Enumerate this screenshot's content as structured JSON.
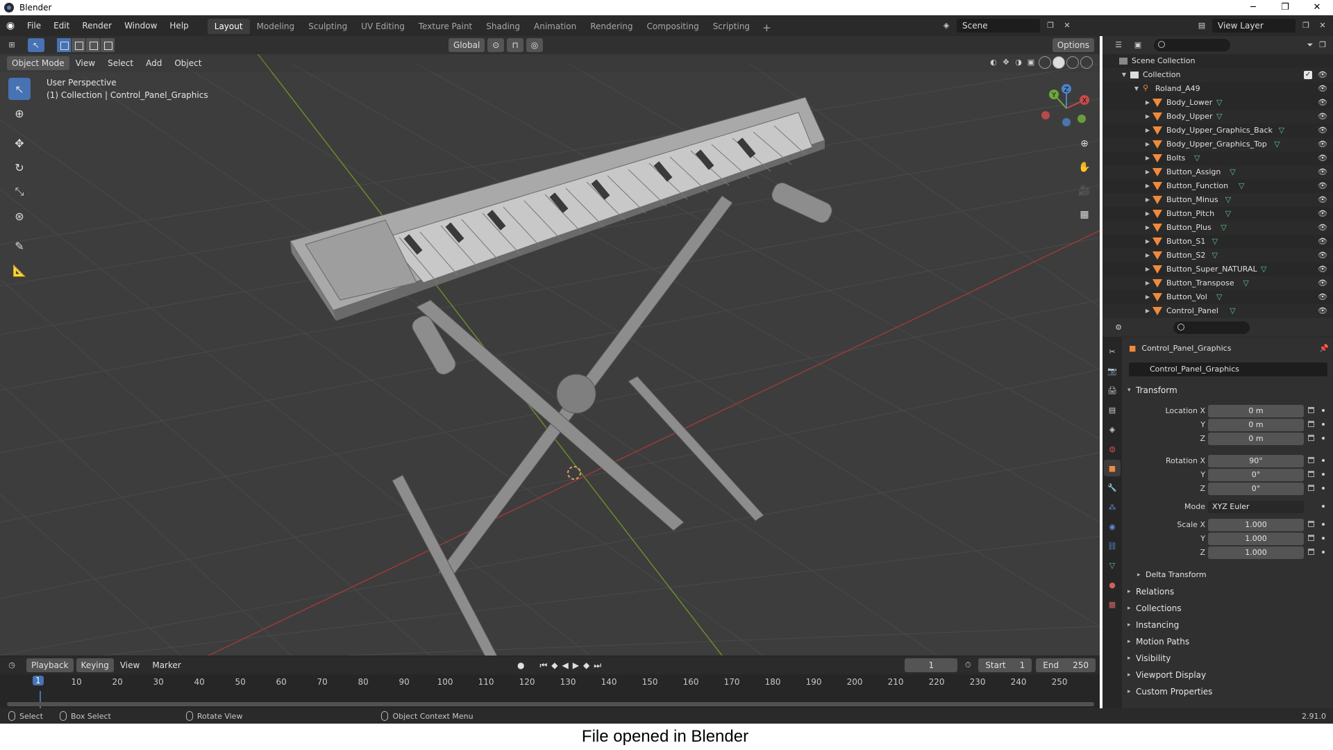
{
  "window": {
    "title": "Blender",
    "controls": [
      "─",
      "❐",
      "✕"
    ]
  },
  "menu": [
    "File",
    "Edit",
    "Render",
    "Window",
    "Help"
  ],
  "workspaces": [
    {
      "label": "Layout",
      "active": true
    },
    {
      "label": "Modeling"
    },
    {
      "label": "Sculpting"
    },
    {
      "label": "UV Editing"
    },
    {
      "label": "Texture Paint"
    },
    {
      "label": "Shading"
    },
    {
      "label": "Animation"
    },
    {
      "label": "Rendering"
    },
    {
      "label": "Compositing"
    },
    {
      "label": "Scripting"
    }
  ],
  "add_workspace": "+",
  "scene": {
    "value": "Scene"
  },
  "view_layer": {
    "value": "View Layer"
  },
  "viewport": {
    "mode": "Object Mode",
    "menus": [
      "View",
      "Select",
      "Add",
      "Object"
    ],
    "transform_orientation": "Global",
    "options": "Options",
    "perspective": "User Perspective",
    "collection_info": "(1) Collection | Control_Panel_Graphics",
    "gizmo": {
      "x": "X",
      "y": "Y",
      "z": "Z"
    }
  },
  "outliner": {
    "root": "Scene Collection",
    "collection": "Collection",
    "parent": "Roland_A49",
    "children": [
      "Body_Lower",
      "Body_Upper",
      "Body_Upper_Graphics_Back",
      "Body_Upper_Graphics_Top",
      "Bolts",
      "Button_Assign",
      "Button_Function",
      "Button_Minus",
      "Button_Pitch",
      "Button_Plus",
      "Button_S1",
      "Button_S2",
      "Button_Super_NATURAL",
      "Button_Transpose",
      "Button_Vol",
      "Control_Panel"
    ]
  },
  "properties": {
    "object_name": "Control_Panel_Graphics",
    "data_name": "Control_Panel_Graphics",
    "transform": {
      "title": "Transform",
      "location_label": "Location X",
      "location": [
        "0 m",
        "0 m",
        "0 m"
      ],
      "rotation_label": "Rotation X",
      "rotation": [
        "90°",
        "0°",
        "0°"
      ],
      "mode_label": "Mode",
      "mode": "XYZ Euler",
      "scale_label": "Scale X",
      "scale": [
        "1.000",
        "1.000",
        "1.000"
      ],
      "axis_y": "Y",
      "axis_z": "Z",
      "delta": "Delta Transform"
    },
    "panels": [
      "Relations",
      "Collections",
      "Instancing",
      "Motion Paths",
      "Visibility",
      "Viewport Display",
      "Custom Properties"
    ]
  },
  "timeline": {
    "menus": [
      "Playback",
      "Keying",
      "View",
      "Marker"
    ],
    "current_frame": "1",
    "start_label": "Start",
    "start": "1",
    "end_label": "End",
    "end": "250",
    "ticks": [
      "10",
      "20",
      "30",
      "40",
      "50",
      "60",
      "70",
      "80",
      "90",
      "100",
      "110",
      "120",
      "130",
      "140",
      "150",
      "160",
      "170",
      "180",
      "190",
      "200",
      "210",
      "220",
      "230",
      "240",
      "250"
    ]
  },
  "status": {
    "select": "Select",
    "box_select": "Box Select",
    "rotate_view": "Rotate View",
    "context_menu": "Object Context Menu",
    "version": "2.91.0"
  },
  "caption": "File opened in Blender",
  "colors": {
    "accent": "#4772b3",
    "viewport_bg": "#3d3d3d",
    "mesh_green": "#5fc986",
    "object_orange": "#ef8a3d"
  }
}
